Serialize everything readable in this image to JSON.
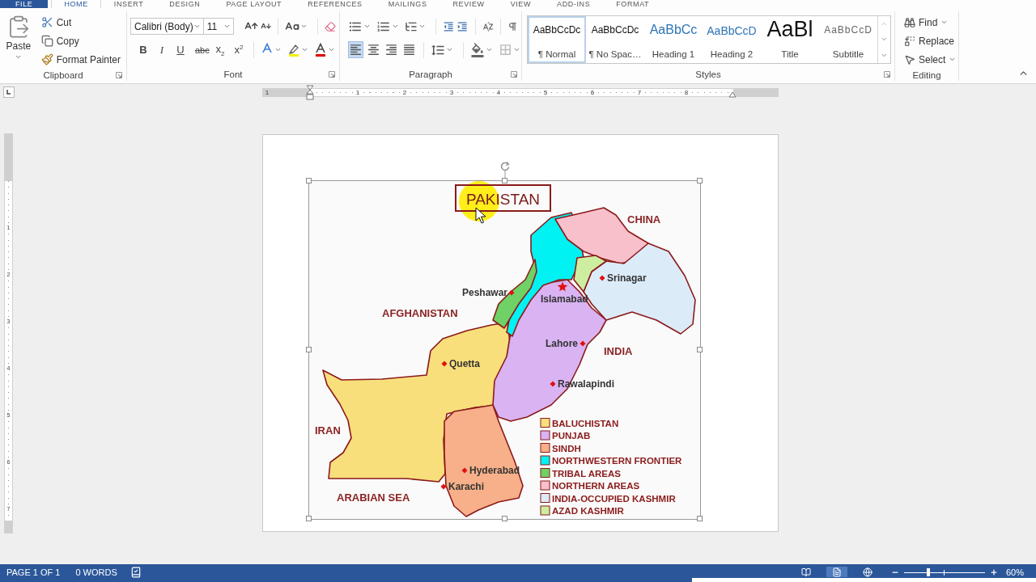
{
  "tabs": [
    {
      "label": "FILE",
      "kind": "file",
      "selected": false
    },
    {
      "label": "HOME",
      "kind": "tab",
      "selected": true
    },
    {
      "label": "INSERT",
      "kind": "tab",
      "selected": false
    },
    {
      "label": "DESIGN",
      "kind": "tab",
      "selected": false
    },
    {
      "label": "PAGE LAYOUT",
      "kind": "tab",
      "selected": false
    },
    {
      "label": "REFERENCES",
      "kind": "tab",
      "selected": false
    },
    {
      "label": "MAILINGS",
      "kind": "tab",
      "selected": false
    },
    {
      "label": "REVIEW",
      "kind": "tab",
      "selected": false
    },
    {
      "label": "VIEW",
      "kind": "tab",
      "selected": false
    },
    {
      "label": "ADD-INS",
      "kind": "tab",
      "selected": false
    },
    {
      "label": "FORMAT",
      "kind": "tab",
      "selected": false
    }
  ],
  "ribbon": {
    "clipboard": {
      "label": "Clipboard",
      "paste": "Paste",
      "commands": [
        {
          "kind": "cut",
          "label": "Cut"
        },
        {
          "kind": "copy",
          "label": "Copy"
        },
        {
          "kind": "format_painter",
          "label": "Format Painter"
        }
      ]
    },
    "font": {
      "label": "Font",
      "font_name": "Calibri (Body)",
      "font_size": "11",
      "format_buttons": [
        {
          "kind": "bold",
          "label": "B"
        },
        {
          "kind": "italic",
          "label": "I"
        },
        {
          "kind": "underline",
          "label": "U"
        },
        {
          "kind": "strike",
          "label": "abc"
        },
        {
          "kind": "subscript",
          "label": "x$_{2}$"
        },
        {
          "kind": "superscript",
          "label": "x$^{2}$"
        }
      ]
    },
    "paragraph": {
      "label": "Paragraph",
      "alignment": [
        {
          "kind": "left",
          "selected": true
        },
        {
          "kind": "center",
          "selected": false
        },
        {
          "kind": "right",
          "selected": false
        },
        {
          "kind": "justify",
          "selected": false
        }
      ]
    },
    "styles": {
      "label": "Styles",
      "items": [
        {
          "kind": "normal",
          "preview": "AaBbCcDc",
          "name": "¶ Normal",
          "selected": true
        },
        {
          "kind": "no_spacing",
          "preview": "AaBbCcDc",
          "name": "¶ No Spac…",
          "selected": false
        },
        {
          "kind": "heading1",
          "preview": "AaBbCc",
          "name": "Heading 1",
          "selected": false
        },
        {
          "kind": "heading2",
          "preview": "AaBbCcD",
          "name": "Heading 2",
          "selected": false
        },
        {
          "kind": "title",
          "preview": "AaBl",
          "name": "Title",
          "selected": false
        },
        {
          "kind": "subtitle",
          "preview": "AaBbCcD",
          "name": "Subtitle",
          "selected": false
        }
      ]
    },
    "editing": {
      "label": "Editing",
      "commands": [
        {
          "kind": "find",
          "label": "Find"
        },
        {
          "kind": "replace",
          "label": "Replace"
        },
        {
          "kind": "select",
          "label": "Select"
        }
      ]
    }
  },
  "ruler": {
    "numbers": [
      "1",
      "1",
      "2",
      "3",
      "4",
      "5",
      "6",
      "7",
      "8"
    ]
  },
  "vertical_ruler": {
    "numbers": [
      "1",
      "2",
      "3",
      "4",
      "5",
      "6",
      "7"
    ]
  },
  "picture": {
    "title": "PAKISTAN",
    "places": [
      "CHINA",
      "AFGHANISTAN",
      "INDIA",
      "IRAN",
      "ARABIAN SEA"
    ],
    "cities": [
      {
        "name": "Srinagar",
        "kind": "city"
      },
      {
        "name": "Peshawar",
        "kind": "city"
      },
      {
        "name": "Islamabad",
        "kind": "capital"
      },
      {
        "name": "Lahore",
        "kind": "city"
      },
      {
        "name": "Quetta",
        "kind": "city"
      },
      {
        "name": "Rawalapindi",
        "kind": "city"
      },
      {
        "name": "Hyderabad",
        "kind": "city"
      },
      {
        "name": "Karachi",
        "kind": "city"
      }
    ],
    "legend": [
      {
        "name": "BALUCHISTAN",
        "color": "#f8df7c"
      },
      {
        "name": "PUNJAB",
        "color": "#d9b3f2"
      },
      {
        "name": "SINDH",
        "color": "#f7b089"
      },
      {
        "name": "NORTHWESTERN FRONTIER",
        "color": "#00f2f2"
      },
      {
        "name": "TRIBAL AREAS",
        "color": "#6fd166"
      },
      {
        "name": "NORTHERN AREAS",
        "color": "#f7c0cb"
      },
      {
        "name": "INDIA-OCCUPIED KASHMIR",
        "color": "#dcebf8"
      },
      {
        "name": "AZAD KASHMIR",
        "color": "#cdeea0"
      }
    ]
  },
  "status_bar": {
    "page": "PAGE 1 OF 1",
    "words": "0 WORDS",
    "views": [
      {
        "kind": "read",
        "selected": false
      },
      {
        "kind": "print",
        "selected": true
      },
      {
        "kind": "web",
        "selected": false
      }
    ],
    "zoom": {
      "level": 0.3,
      "reading": "60%"
    }
  }
}
